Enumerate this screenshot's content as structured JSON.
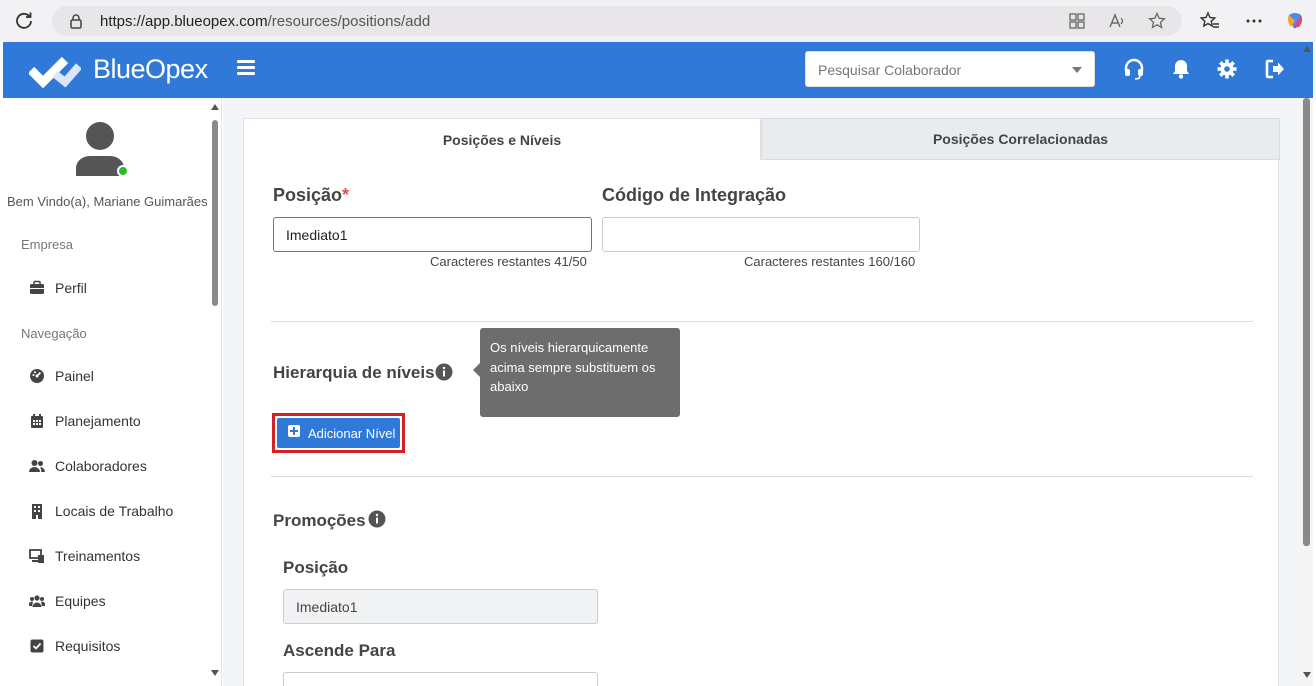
{
  "browser": {
    "url_host": "https://app.blueopex.com",
    "url_path": "/resources/positions/add"
  },
  "header": {
    "brand": "BlueOpex",
    "search_placeholder": "Pesquisar Colaborador",
    "accent_color": "#3079d9"
  },
  "sidebar": {
    "welcome": "Bem Vindo(a), Mariane Guimarães",
    "section_company": "Empresa",
    "section_nav": "Navegação",
    "items": [
      {
        "label": "Perfil",
        "icon": "briefcase-icon"
      },
      {
        "label": "Painel",
        "icon": "dashboard-icon"
      },
      {
        "label": "Planejamento",
        "icon": "calendar-icon"
      },
      {
        "label": "Colaboradores",
        "icon": "users-icon"
      },
      {
        "label": "Locais de Trabalho",
        "icon": "building-icon"
      },
      {
        "label": "Treinamentos",
        "icon": "training-icon"
      },
      {
        "label": "Equipes",
        "icon": "team-icon"
      },
      {
        "label": "Requisitos",
        "icon": "checkbox-icon"
      }
    ]
  },
  "tabs": {
    "positions_levels": "Posições e Níveis",
    "correlated": "Posições Correlacionadas"
  },
  "form": {
    "position_label": "Posição",
    "required_mark": "*",
    "position_value": "Imediato1",
    "position_counter": "Caracteres restantes 41/50",
    "integration_label": "Código de Integração",
    "integration_value": "",
    "integration_counter": "Caracteres restantes 160/160",
    "hierarchy_label": "Hierarquia de níveis",
    "tooltip": "Os níveis hierarquicamente acima sempre substituem os abaixo",
    "add_level_button": "Adicionar Nível",
    "promotions_label": "Promoções",
    "promo_position_label": "Posição",
    "promo_position_value": "Imediato1",
    "ascends_to_label": "Ascende Para"
  }
}
